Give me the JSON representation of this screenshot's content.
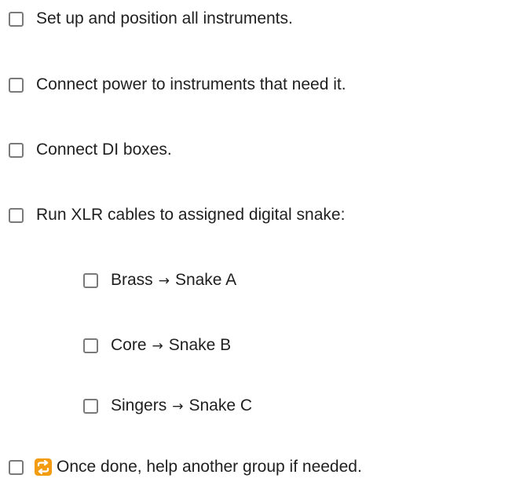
{
  "checklist": {
    "items": [
      {
        "label": "Set up and position all instruments."
      },
      {
        "label": "Connect power to instruments that need it."
      },
      {
        "label": "Connect DI boxes."
      },
      {
        "label": "Run XLR cables to assigned digital snake:"
      }
    ],
    "sub_items": [
      {
        "from": "Brass",
        "arrow": "→",
        "to": "Snake A"
      },
      {
        "from": "Core",
        "arrow": "→",
        "to": "Snake B"
      },
      {
        "from": "Singers",
        "arrow": "→",
        "to": "Snake C"
      }
    ],
    "final_item": {
      "icon": "repeat-icon",
      "label": "Once done, help another group if needed."
    },
    "colors": {
      "checkbox_border": "#7a7a7a",
      "text": "#1f1f1f",
      "emoji_bg": "#f39c12"
    }
  }
}
